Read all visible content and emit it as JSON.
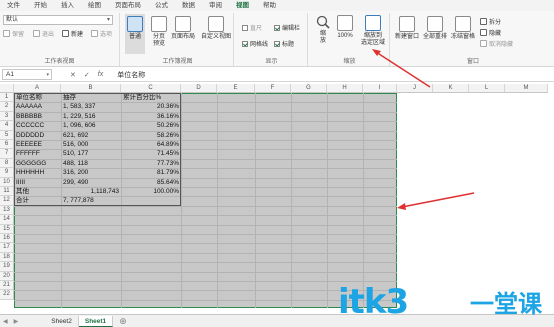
{
  "menu": [
    "文件",
    "开始",
    "插入",
    "绘图",
    "页面布局",
    "公式",
    "数据",
    "审阅",
    "视图",
    "帮助"
  ],
  "menu_active": "视图",
  "ribbon": {
    "workbook_views": {
      "dropdown_value": "默认",
      "small_buttons": [
        "保留",
        "退出",
        "新建",
        "选项"
      ],
      "label1": "工作表视图",
      "normal": "普通",
      "page_break": "分页\n预览",
      "page_layout": "页面布局",
      "custom_views": "自定义视图",
      "label2": "工作簿视图"
    },
    "show": {
      "ruler": "直尺",
      "formula_bar": "编辑栏",
      "gridlines": "网格线",
      "headings": "标题",
      "label": "显示"
    },
    "zoom": {
      "zoom": "缩\n放",
      "zoom100": "100%",
      "zoom_selection": "缩放到\n选定区域",
      "label": "缩放"
    },
    "window": {
      "new_window": "新建窗口",
      "arrange_all": "全部重排",
      "freeze": "冻结窗格",
      "split": "拆分",
      "hide": "隐藏",
      "unhide": "取消隐藏",
      "label": "窗口"
    }
  },
  "formula_bar": {
    "name_box": "A1",
    "cancel": "✕",
    "enter": "✓",
    "fx": "fx",
    "value": "单位名称"
  },
  "columns": [
    "A",
    "B",
    "C",
    "D",
    "E",
    "F",
    "G",
    "H",
    "I",
    "J",
    "K",
    "L",
    "M"
  ],
  "rows": [
    "1",
    "2",
    "3",
    "4",
    "5",
    "6",
    "7",
    "8",
    "9",
    "10",
    "11",
    "12",
    "13",
    "14",
    "15",
    "16",
    "17",
    "18",
    "19",
    "20",
    "21",
    "22"
  ],
  "table": {
    "header": [
      "单位名称",
      "抽存",
      "累计百分比%"
    ],
    "rows": [
      [
        "AAAAAA",
        "1, 583, 337",
        "20.36%"
      ],
      [
        "BBBBBB",
        "1, 229, 516",
        "36.16%"
      ],
      [
        "CCCCCC",
        "1, 096, 606",
        "50.26%"
      ],
      [
        "DDDDDD",
        "621, 692",
        "58.26%"
      ],
      [
        "EEEEEE",
        "516, 000",
        "64.89%"
      ],
      [
        "FFFFFF",
        "510, 177",
        "71.45%"
      ],
      [
        "GGGGGG",
        "488, 118",
        "77.73%"
      ],
      [
        "HHHHHH",
        "316, 200",
        "81.79%"
      ],
      [
        "IIIII",
        "299, 490",
        "85.64%"
      ],
      [
        "其他",
        "1,118,743",
        "100.00%"
      ],
      [
        "合计",
        "7, 777,878",
        ""
      ]
    ]
  },
  "tabs": [
    "Sheet2",
    "Sheet1"
  ],
  "active_tab": "Sheet1",
  "add_sheet": "⊕",
  "watermark": {
    "latin": "itk3",
    "cn": "一堂课"
  },
  "colors": {
    "accent": "#217346",
    "selection_grey": "#c8c8c8",
    "arrow": "#e03030",
    "watermark": "#1da4e4"
  }
}
